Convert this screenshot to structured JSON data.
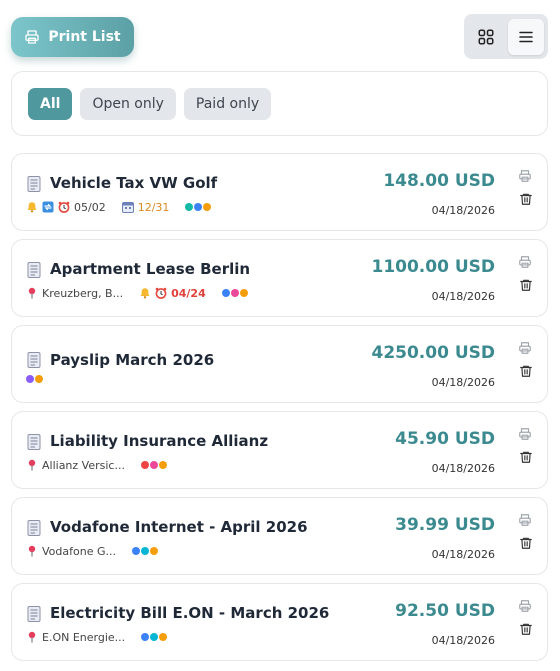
{
  "toolbar": {
    "print_label": "Print List"
  },
  "filters": [
    {
      "label": "All",
      "active": true
    },
    {
      "label": "Open only",
      "active": false
    },
    {
      "label": "Paid only",
      "active": false
    }
  ],
  "colors": {
    "accent": "#4f989d",
    "amount": "#3b8a8f",
    "overdue": "#e0413b",
    "due": "#d8891f"
  },
  "items": [
    {
      "title": "Vehicle Tax VW Golf",
      "amount": "148.00 USD",
      "date": "04/18/2026",
      "meta": {
        "reminder": "05/02",
        "calendar": "12/31"
      },
      "tag_colors": [
        "#14b8a6",
        "#3b82f6",
        "#f59e0b"
      ]
    },
    {
      "title": "Apartment Lease Berlin",
      "amount": "1100.00 USD",
      "date": "04/18/2026",
      "meta": {
        "location": "Kreuzberg, B...",
        "reminder": "04/24"
      },
      "tag_colors": [
        "#3b82f6",
        "#ec4899",
        "#f59e0b"
      ]
    },
    {
      "title": "Payslip March 2026",
      "amount": "4250.00 USD",
      "date": "04/18/2026",
      "meta": {},
      "tag_colors": [
        "#8b5cf6",
        "#f59e0b"
      ]
    },
    {
      "title": "Liability Insurance Allianz",
      "amount": "45.90 USD",
      "date": "04/18/2026",
      "meta": {
        "location": "Allianz Versic..."
      },
      "tag_colors": [
        "#ef4444",
        "#ec4899",
        "#f59e0b"
      ]
    },
    {
      "title": "Vodafone Internet - April 2026",
      "amount": "39.99 USD",
      "date": "04/18/2026",
      "meta": {
        "location": "Vodafone G..."
      },
      "tag_colors": [
        "#3b82f6",
        "#06b6d4",
        "#f59e0b"
      ]
    },
    {
      "title": "Electricity Bill E.ON - March 2026",
      "amount": "92.50 USD",
      "date": "04/18/2026",
      "meta": {
        "location": "E.ON Energie..."
      },
      "tag_colors": [
        "#3b82f6",
        "#06b6d4",
        "#f59e0b"
      ]
    }
  ]
}
